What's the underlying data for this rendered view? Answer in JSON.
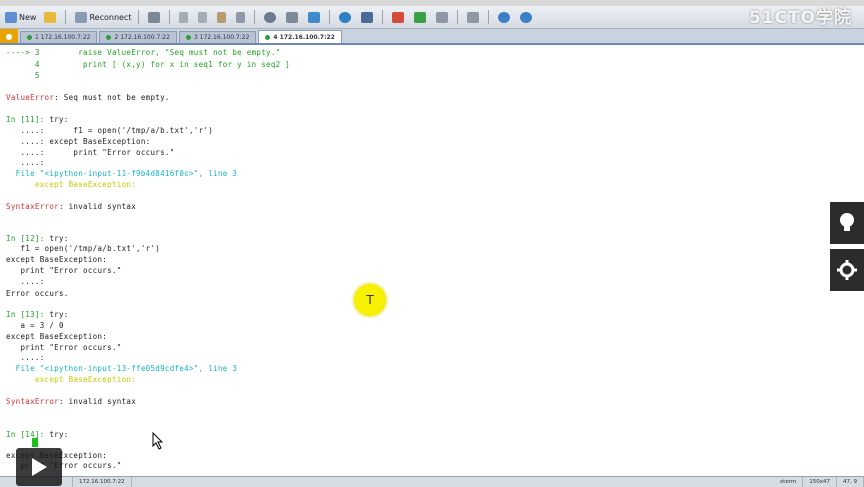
{
  "toolbar": {
    "new_label": "New",
    "reconnect_label": "Reconnect"
  },
  "watermark": "51CTO学院",
  "tabs": [
    {
      "label": "1 172.16.100.7:22"
    },
    {
      "label": "2 172.16.100.7:22"
    },
    {
      "label": "3 172.16.100.7:22"
    },
    {
      "label": "4 172.16.100.7:22"
    }
  ],
  "terminal": {
    "arrow": "---->",
    "l1_num": " 3",
    "l1_code": "        raise ValueError, \"Seq must not be empty.\"",
    "l2": "      4         print [ (x,y) for x in seq1 for y in seq2 ]",
    "l3": "      5",
    "l4_err": "ValueError",
    "l4_msg": ": Seq must not be empty.",
    "l5_in": "In [11]:",
    "l5_code": " try:",
    "l6": "   ....:      f1 = open('/tmp/a/b.txt','r')",
    "l7": "   ....: except BaseException:",
    "l8": "   ....:      print \"Error occurs.\"",
    "l9": "   ....:",
    "l10_file": "  File \"<ipython-input-11-f9b4d8416f0c>\", line 3",
    "l11": "      except BaseException:",
    "l12_err": "SyntaxError",
    "l12_msg": ": invalid syntax",
    "l13_in": "In [12]:",
    "l13_code": " try:",
    "l14": "   f1 = open('/tmp/a/b.txt','r')",
    "l15": "except BaseException:",
    "l16": "   print \"Error occurs.\"",
    "l17": "   ....:",
    "l18": "Error occurs.",
    "l19_in": "In [13]:",
    "l19_code": " try:",
    "l20": "   a = 3 / 0",
    "l21": "except BaseException:",
    "l22": "   print \"Error occurs.\"",
    "l23": "   ....:",
    "l24_file": "  File \"<ipython-input-13-ffe05d9cdfe4>\", line 3",
    "l25": "      except BaseException:",
    "l26_err": "SyntaxError",
    "l26_msg": ": invalid syntax",
    "l27_in": "In [14]:",
    "l27_code": " try:",
    "l28": "except BaseException:",
    "l29": "   print \"Error occurs.\""
  },
  "cursor_letter": "T",
  "status": {
    "host": "172.16.100.7:22",
    "term": "xterm",
    "size": "150x47",
    "pos": "47, 9"
  },
  "colors": {
    "prompt_green": "#21a021",
    "error_red": "#d33131",
    "file_cyan": "#13b3c2",
    "highlight_yellow": "#c6c900"
  }
}
